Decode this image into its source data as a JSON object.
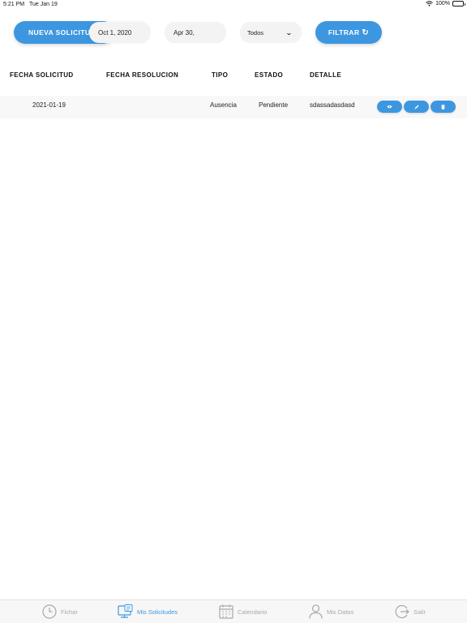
{
  "status_bar": {
    "time": "5:21 PM",
    "date": "Tue Jan 19",
    "battery": "100%"
  },
  "toolbar": {
    "new_request_label": "NUEVA SOLICITUD",
    "date_from": "Oct 1, 2020",
    "date_to": "Apr 30,",
    "type_select": "Todos",
    "filter_label": "FILTRAR",
    "refresh_glyph": "↻"
  },
  "table": {
    "columns": [
      "FECHA SOLICITUD",
      "FECHA RESOLUCION",
      "TIPO",
      "ESTADO",
      "DETALLE"
    ],
    "rows": [
      {
        "fecha_solicitud": "2021-01-19",
        "fecha_resolucion": "",
        "tipo": "Ausencia",
        "estado": "Pendiente",
        "detalle": "sdassadasdasd"
      }
    ]
  },
  "tab_bar": {
    "tabs": [
      {
        "label": "Fichar",
        "icon": "clock-icon",
        "active": false
      },
      {
        "label": "Mis Solicitudes",
        "icon": "monitor-list-icon",
        "active": true
      },
      {
        "label": "Calendario",
        "icon": "calendar-icon",
        "active": false
      },
      {
        "label": "Mis Datos",
        "icon": "user-icon",
        "active": false
      },
      {
        "label": "Salir",
        "icon": "logout-icon",
        "active": false
      }
    ]
  },
  "colors": {
    "accent": "#3d97e0",
    "inactive_tab": "#a8a8a8",
    "pill_bg": "#f3f3f3",
    "row_bg": "#f8f8f8"
  }
}
